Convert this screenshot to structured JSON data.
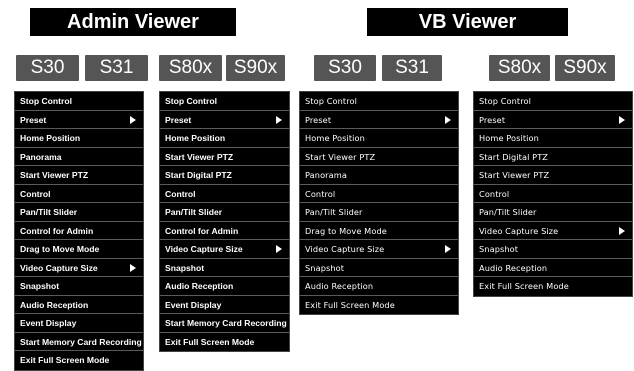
{
  "titles": {
    "admin": "Admin Viewer",
    "vb": "VB Viewer"
  },
  "badges": {
    "s30": "S30",
    "s31": "S31",
    "s80x": "S80x",
    "s90x": "S90x"
  },
  "menus": {
    "admin_s30_s31": [
      {
        "label": "Stop Control",
        "submenu": false
      },
      {
        "label": "Preset",
        "submenu": true
      },
      {
        "label": "Home Position",
        "submenu": false
      },
      {
        "label": "Panorama",
        "submenu": false
      },
      {
        "label": "Start Viewer PTZ",
        "submenu": false
      },
      {
        "label": "Control",
        "submenu": false
      },
      {
        "label": "Pan/Tilt Slider",
        "submenu": false
      },
      {
        "label": "Control for Admin",
        "submenu": false
      },
      {
        "label": "Drag to Move Mode",
        "submenu": false
      },
      {
        "label": "Video Capture Size",
        "submenu": true
      },
      {
        "label": "Snapshot",
        "submenu": false
      },
      {
        "label": "Audio Reception",
        "submenu": false
      },
      {
        "label": "Event Display",
        "submenu": false
      },
      {
        "label": "Start Memory Card Recording",
        "submenu": false
      },
      {
        "label": "Exit Full Screen Mode",
        "submenu": false
      }
    ],
    "admin_s80x_s90x": [
      {
        "label": "Stop Control",
        "submenu": false
      },
      {
        "label": "Preset",
        "submenu": true
      },
      {
        "label": "Home Position",
        "submenu": false
      },
      {
        "label": "Start Viewer PTZ",
        "submenu": false
      },
      {
        "label": "Start Digital PTZ",
        "submenu": false
      },
      {
        "label": "Control",
        "submenu": false
      },
      {
        "label": "Pan/Tilt Slider",
        "submenu": false
      },
      {
        "label": "Control for Admin",
        "submenu": false
      },
      {
        "label": "Video Capture Size",
        "submenu": true
      },
      {
        "label": "Snapshot",
        "submenu": false
      },
      {
        "label": "Audio Reception",
        "submenu": false
      },
      {
        "label": "Event Display",
        "submenu": false
      },
      {
        "label": "Start Memory Card Recording",
        "submenu": false
      },
      {
        "label": "Exit Full Screen Mode",
        "submenu": false
      }
    ],
    "vb_s30_s31": [
      {
        "label": "Stop Control",
        "submenu": false
      },
      {
        "label": "Preset",
        "submenu": true
      },
      {
        "label": "Home Position",
        "submenu": false
      },
      {
        "label": "Start Viewer PTZ",
        "submenu": false
      },
      {
        "label": "Panorama",
        "submenu": false
      },
      {
        "label": "Control",
        "submenu": false
      },
      {
        "label": "Pan/Tilt Slider",
        "submenu": false
      },
      {
        "label": "Drag to Move Mode",
        "submenu": false
      },
      {
        "label": "Video Capture Size",
        "submenu": true
      },
      {
        "label": "Snapshot",
        "submenu": false
      },
      {
        "label": "Audio Reception",
        "submenu": false
      },
      {
        "label": "Exit Full Screen Mode",
        "submenu": false
      }
    ],
    "vb_s80x_s90x": [
      {
        "label": "Stop Control",
        "submenu": false
      },
      {
        "label": "Preset",
        "submenu": true
      },
      {
        "label": "Home Position",
        "submenu": false
      },
      {
        "label": "Start Digital PTZ",
        "submenu": false
      },
      {
        "label": "Start Viewer PTZ",
        "submenu": false
      },
      {
        "label": "Control",
        "submenu": false
      },
      {
        "label": "Pan/Tilt Slider",
        "submenu": false
      },
      {
        "label": "Video Capture Size",
        "submenu": true
      },
      {
        "label": "Snapshot",
        "submenu": false
      },
      {
        "label": "Audio Reception",
        "submenu": false
      },
      {
        "label": "Exit Full Screen Mode",
        "submenu": false
      }
    ]
  }
}
